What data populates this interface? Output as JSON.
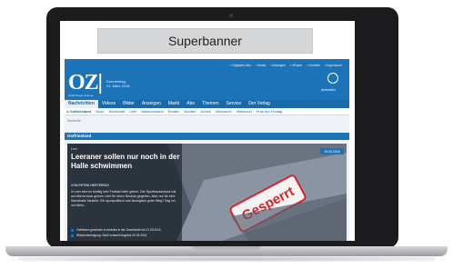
{
  "banner": {
    "label": "Superbanner"
  },
  "site": {
    "logo": "OZ|",
    "logo_sub": "Ostthüringer Zeitung",
    "date_lines": [
      "Donnerstag,",
      "21. März 2016"
    ],
    "top_links": [
      "▪ Digitales Abo",
      "▪ Musik",
      "▪ Anzeigen",
      "▪ ePaper",
      "▪ Kontakt",
      "▪ Impressum"
    ],
    "login_label": "Anmelden"
  },
  "nav": {
    "items": [
      "Nachrichten",
      "Videos",
      "Bilder",
      "Anzeigen",
      "Markt",
      "Abo",
      "Themen",
      "Service",
      "Der Verlag"
    ],
    "active_index": 0
  },
  "subnav": {
    "items": [
      "▸ Ostfriesland",
      "Sport",
      "Wirtschaft",
      "Leer",
      "Westoverland",
      "Emden",
      "Norden",
      "Aurich",
      "Wiesmoor",
      "Wittmund",
      "Frau am Freitag"
    ]
  },
  "breadcrumb": "Startseite",
  "section": {
    "title": "Ostfriesland"
  },
  "teaser": {
    "kicker": "Leer",
    "headline": "Leeraner sollen nur noch in der Halle schwimmen",
    "author": "VON PETRA HERTERICH",
    "text": "In Leer wird es künftig kein Freibad mehr geben. Der Sporthausschuss hat am Abend zwar grünes Licht für einen Neubau gegeben. Aber nur für eine Standhalle Variante. Ein sportpolitisch und ökologisch guter Weg? Sag ich nur Mehr...",
    "date_stamp": "19.03.2016",
    "sign_text": "Gesperrt",
    "related": [
      "Ostfriesen gewinnen in Amerika in der Geschichte ein 21.03.2016",
      "Wiedervereinigung: Stahl verkauft Angebot 20.03.2016"
    ]
  },
  "colors": {
    "brand_blue": "#1d73b8",
    "nav_blue": "#1a6aa9",
    "sign_red": "#d8232a"
  }
}
